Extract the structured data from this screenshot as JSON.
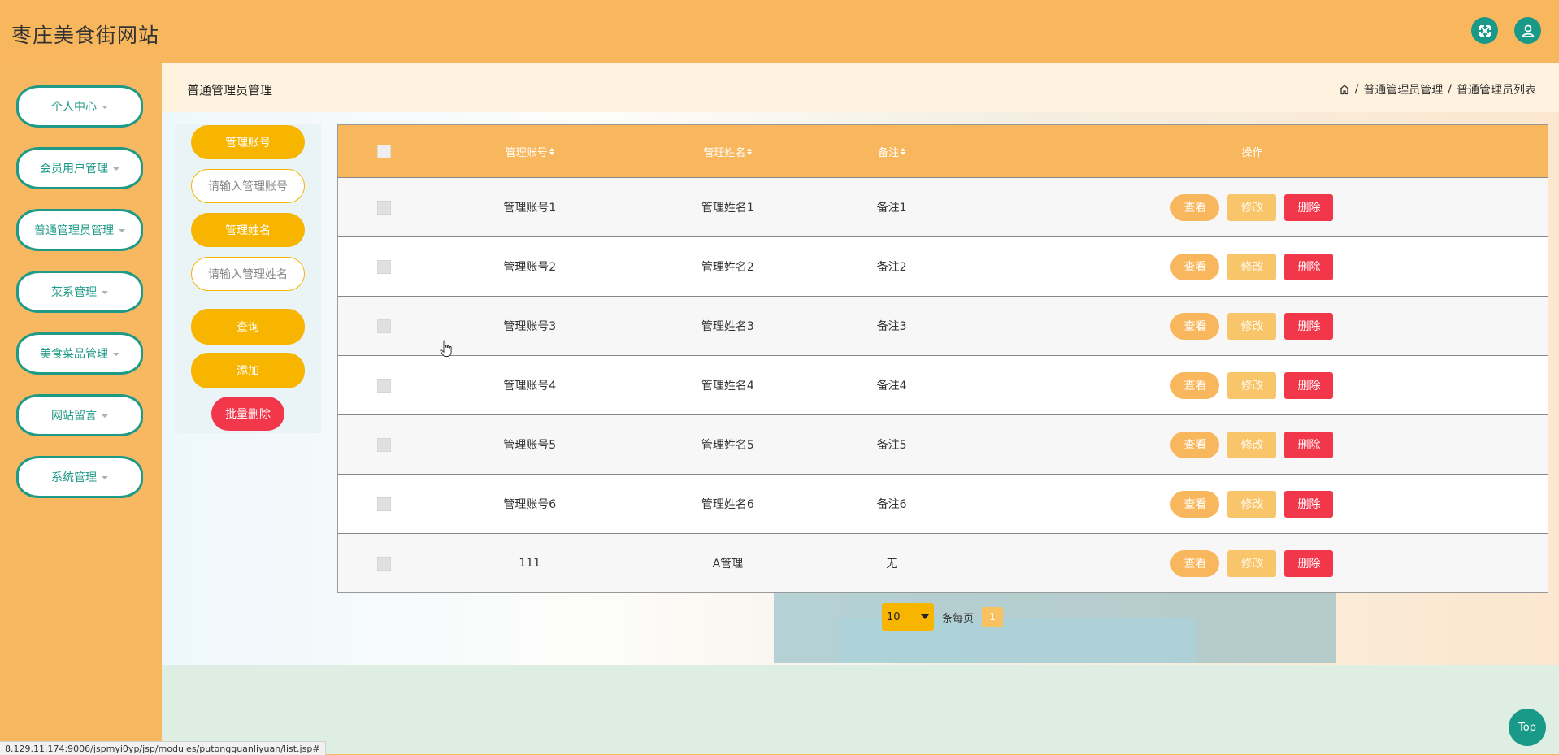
{
  "header": {
    "site_title": "枣庄美食街网站",
    "fullscreen_icon": "expand-arrows-icon",
    "user_icon": "user-icon"
  },
  "sidebar": {
    "items": [
      {
        "label": "个人中心"
      },
      {
        "label": "会员用户管理"
      },
      {
        "label": "普通管理员管理"
      },
      {
        "label": "菜系管理"
      },
      {
        "label": "美食菜品管理"
      },
      {
        "label": "网站留言"
      },
      {
        "label": "系统管理"
      }
    ]
  },
  "page": {
    "title": "普通管理员管理",
    "breadcrumb": [
      "普通管理员管理",
      "普通管理员列表"
    ],
    "separator": "/"
  },
  "filters": {
    "account_label": "管理账号",
    "account_placeholder": "请输入管理账号",
    "name_label": "管理姓名",
    "name_placeholder": "请输入管理姓名",
    "search_button": "查询",
    "add_button": "添加",
    "batch_delete_button": "批量删除"
  },
  "table": {
    "columns": [
      "管理账号",
      "管理姓名",
      "备注",
      "操作"
    ],
    "actions": {
      "view": "查看",
      "edit": "修改",
      "delete": "删除"
    },
    "rows": [
      {
        "account": "管理账号1",
        "name": "管理姓名1",
        "note": "备注1"
      },
      {
        "account": "管理账号2",
        "name": "管理姓名2",
        "note": "备注2"
      },
      {
        "account": "管理账号3",
        "name": "管理姓名3",
        "note": "备注3"
      },
      {
        "account": "管理账号4",
        "name": "管理姓名4",
        "note": "备注4"
      },
      {
        "account": "管理账号5",
        "name": "管理姓名5",
        "note": "备注5"
      },
      {
        "account": "管理账号6",
        "name": "管理姓名6",
        "note": "备注6"
      },
      {
        "account": "111",
        "name": "A管理",
        "note": "无"
      }
    ]
  },
  "pagination": {
    "page_size": "10",
    "per_page_label": "条每页",
    "current_page": "1"
  },
  "top_button": "Top",
  "status_url": "8.129.11.174:9006/jspmyi0yp/jsp/modules/putongguanliyuan/list.jsp#",
  "colors": {
    "header": "#f9b75d",
    "accent_teal": "#199987",
    "accent_yellow": "#f7b500",
    "danger": "#f2374b"
  }
}
